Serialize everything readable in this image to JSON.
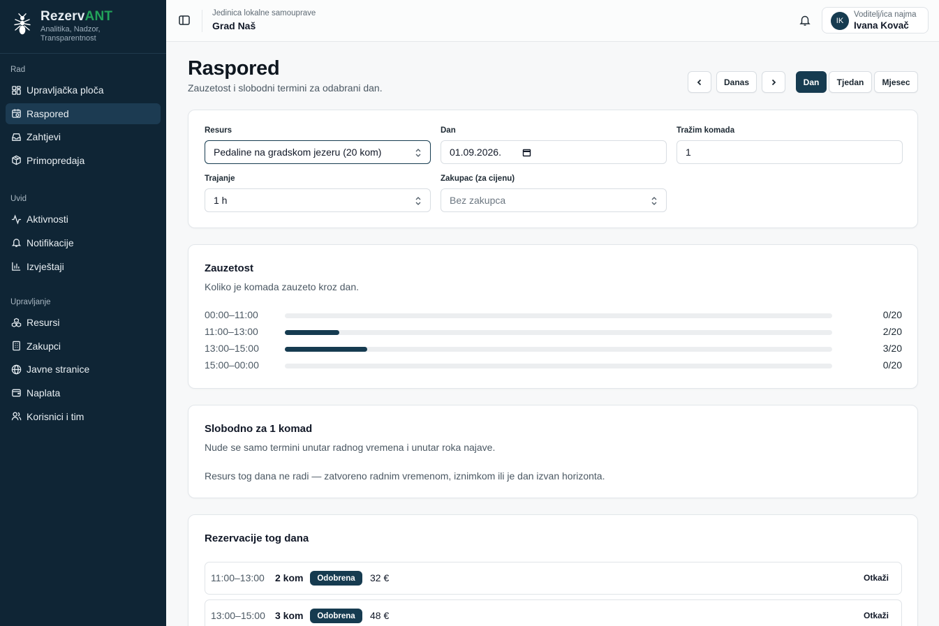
{
  "brand": {
    "name_part1": "Rezerv",
    "name_part2": "ANT",
    "tagline": "Analitika, Nadzor, Transparentnost",
    "accent_color": "#22a35a"
  },
  "sidebar": {
    "sections": [
      {
        "label": "Rad",
        "items": [
          {
            "label": "Upravljačka ploča",
            "icon": "dashboard-icon",
            "active": false
          },
          {
            "label": "Raspored",
            "icon": "calendar-icon",
            "active": true
          },
          {
            "label": "Zahtjevi",
            "icon": "inbox-icon",
            "active": false
          },
          {
            "label": "Primopredaja",
            "icon": "package-icon",
            "active": false
          }
        ]
      },
      {
        "label": "Uvid",
        "items": [
          {
            "label": "Aktivnosti",
            "icon": "activity-icon",
            "active": false
          },
          {
            "label": "Notifikacije",
            "icon": "bell-icon",
            "active": false
          },
          {
            "label": "Izvještaji",
            "icon": "bar-chart-icon",
            "active": false
          }
        ]
      },
      {
        "label": "Upravljanje",
        "items": [
          {
            "label": "Resursi",
            "icon": "boxes-icon",
            "active": false
          },
          {
            "label": "Zakupci",
            "icon": "building-icon",
            "active": false
          },
          {
            "label": "Javne stranice",
            "icon": "globe-icon",
            "active": false
          },
          {
            "label": "Naplata",
            "icon": "wallet-icon",
            "active": false
          },
          {
            "label": "Korisnici i tim",
            "icon": "users-icon",
            "active": false
          }
        ]
      }
    ]
  },
  "header": {
    "org_subtitle": "Jedinica lokalne samouprave",
    "org_title": "Grad Naš",
    "user": {
      "initials": "IK",
      "role": "Voditelj/ica najma",
      "name": "Ivana Kovač"
    }
  },
  "page": {
    "title": "Raspored",
    "subtitle": "Zauzetost i slobodni termini za odabrani dan.",
    "controls": {
      "today": "Danas",
      "views": [
        "Dan",
        "Tjedan",
        "Mjesec"
      ],
      "active_view": "Dan"
    }
  },
  "filters": {
    "resource_label": "Resurs",
    "resource_value": "Pedaline na gradskom jezeru (20 kom)",
    "day_label": "Dan",
    "day_value": "01.09.2026.",
    "qty_label": "Tražim komada",
    "qty_value": "1",
    "duration_label": "Trajanje",
    "duration_value": "1 h",
    "tenant_label": "Zakupac (za cijenu)",
    "tenant_value": "Bez zakupca"
  },
  "occupancy": {
    "title": "Zauzetost",
    "description": "Koliko je komada zauzeto kroz dan.",
    "capacity": 20,
    "rows": [
      {
        "time": "00:00–11:00",
        "booked": 0,
        "label": "0/20"
      },
      {
        "time": "11:00–13:00",
        "booked": 2,
        "label": "2/20"
      },
      {
        "time": "13:00–15:00",
        "booked": 3,
        "label": "3/20"
      },
      {
        "time": "15:00–00:00",
        "booked": 0,
        "label": "0/20"
      }
    ]
  },
  "free": {
    "title": "Slobodno za 1 komad",
    "description": "Nude se samo termini unutar radnog vremena i unutar roka najave.",
    "message": "Resurs tog dana ne radi — zatvoreno radnim vremenom, iznimkom ili je dan izvan horizonta."
  },
  "reservations": {
    "title": "Rezervacije tog dana",
    "items": [
      {
        "time": "11:00–13:00",
        "qty": "2 kom",
        "status": "Odobrena",
        "price": "32 €",
        "action": "Otkaži"
      },
      {
        "time": "13:00–15:00",
        "qty": "3 kom",
        "status": "Odobrena",
        "price": "48 €",
        "action": "Otkaži"
      }
    ]
  },
  "colors": {
    "sidebar_bg": "#0f2535",
    "primary": "#163b50"
  }
}
